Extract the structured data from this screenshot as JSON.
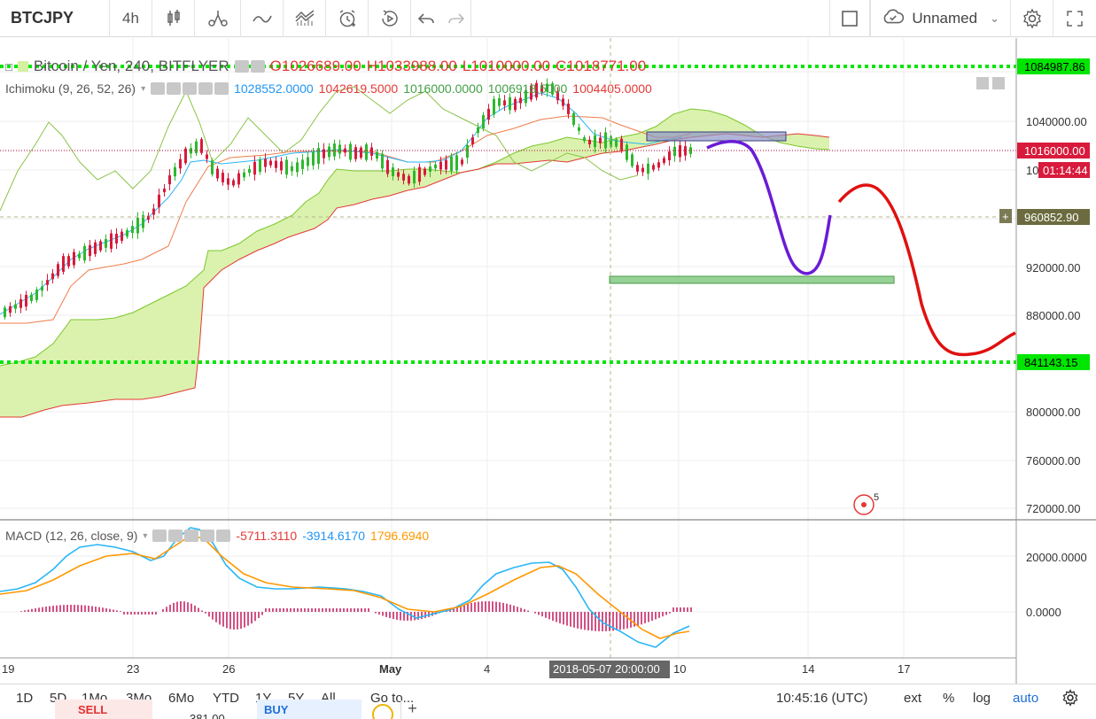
{
  "toolbar": {
    "symbol": "BTCJPY",
    "interval": "4h",
    "icons": [
      "candles-icon",
      "compare-icon",
      "indicators-icon",
      "templates-icon",
      "alert-icon",
      "replay-icon",
      "undo-icon",
      "redo-icon"
    ],
    "layout_name": "Unnamed",
    "right_icons": [
      "fullscreen-square-icon",
      "cloud-icon",
      "settings-gear-icon",
      "expand-icon"
    ]
  },
  "legend": {
    "title": "Bitcoin / Yen, 240, BITFLYER",
    "open": "O1026689.00",
    "high": "H1033988.00",
    "low": "L1010000.00",
    "close": "C1018771.00",
    "ohlc_color": "#e53935"
  },
  "ichimoku": {
    "name": "Ichimoku (9, 26, 52, 26)",
    "values": [
      {
        "text": "1028552.0000",
        "color": "#2196f3"
      },
      {
        "text": "1042619.5000",
        "color": "#e53935"
      },
      {
        "text": "1016000.0000",
        "color": "#43a047"
      },
      {
        "text": "1006918.5000",
        "color": "#43a047"
      },
      {
        "text": "1004405.0000",
        "color": "#e53935"
      }
    ]
  },
  "macd": {
    "name": "MACD (12, 26, close, 9)",
    "values": [
      {
        "text": "-5711.3110",
        "color": "#e53935"
      },
      {
        "text": "-3914.6170",
        "color": "#2196f3"
      },
      {
        "text": "1796.6940",
        "color": "#ff9800"
      }
    ],
    "axis": [
      "20000.0000",
      "0.0000"
    ]
  },
  "price_axis": {
    "ticks": [
      "1040000.00",
      "920000.00",
      "880000.00",
      "800000.00",
      "760000.00",
      "720000.00"
    ],
    "badge_top": "1084987.86",
    "badge_current": "1016000.00",
    "badge_partial": "10",
    "badge_countdown": "01:14:44",
    "badge_crosshair": "960852.90",
    "badge_support": "841143.15"
  },
  "time_axis": {
    "ticks": [
      "19",
      "23",
      "26",
      "May",
      "4",
      "10",
      "14",
      "17"
    ],
    "crosshair_label": "2018-05-07 20:00:00"
  },
  "bottom": {
    "ranges": [
      "1D",
      "5D",
      "1Mo",
      "3Mo",
      "6Mo",
      "YTD",
      "1Y",
      "5Y",
      "All",
      "Go to..."
    ],
    "clock": "10:45:16 (UTC)",
    "ext": "ext",
    "percent": "%",
    "log": "log",
    "auto": "auto"
  },
  "trade": {
    "sell": "SELL",
    "spread": "381.00",
    "buy": "BUY"
  },
  "marker_count": "5",
  "colors": {
    "green_dotted": "#00e600",
    "cloud_fill": "#d4f0a0",
    "forecast_blue": "#6a1bd6",
    "forecast_red": "#e01010",
    "up_candle": "#2eb82e",
    "down_candle": "#d81b3c"
  }
}
